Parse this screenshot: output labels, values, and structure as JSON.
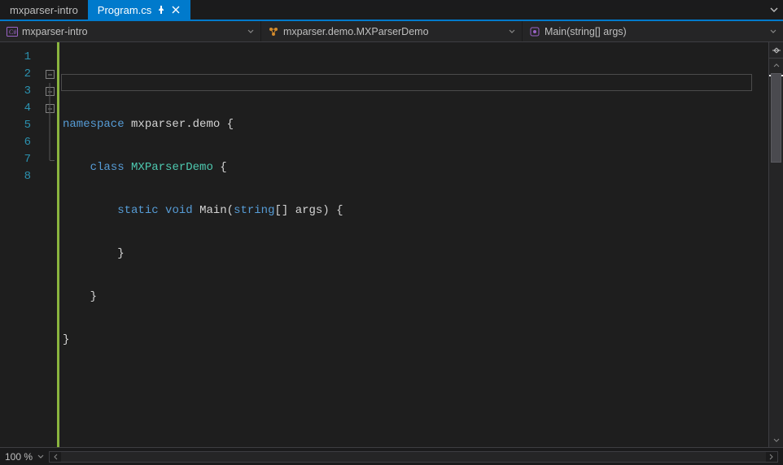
{
  "tabs": {
    "inactive": {
      "label": "mxparser-intro"
    },
    "active": {
      "label": "Program.cs"
    }
  },
  "breadcrumb": {
    "project": "mxparser-intro",
    "namespace": "mxparser.demo.MXParserDemo",
    "member": "Main(string[] args)"
  },
  "editor": {
    "line_numbers": [
      "1",
      "2",
      "3",
      "4",
      "5",
      "6",
      "7",
      "8"
    ],
    "code": {
      "l2": {
        "kw": "namespace",
        "rest": " mxparser.demo {"
      },
      "l3": {
        "indent": "    ",
        "kw": "class",
        "sp": " ",
        "type": "MXParserDemo",
        "rest": " {"
      },
      "l4": {
        "indent": "        ",
        "kw1": "static",
        "sp1": " ",
        "kw2": "void",
        "sp2": " ",
        "name": "Main(",
        "ptype": "string",
        "rest": "[] args) {"
      },
      "l5": "        }",
      "l6": "    }",
      "l7": "}"
    }
  },
  "status": {
    "zoom": "100 %"
  }
}
